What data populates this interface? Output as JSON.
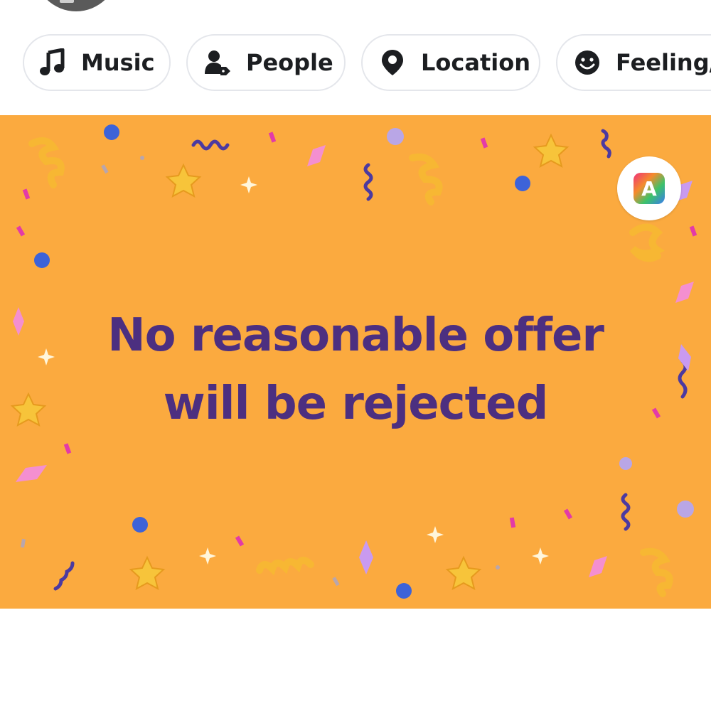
{
  "composer": {
    "attachments": [
      {
        "label": "Music",
        "icon": "music-note-icon"
      },
      {
        "label": "People",
        "icon": "tag-people-icon"
      },
      {
        "label": "Location",
        "icon": "location-pin-icon"
      },
      {
        "label": "Feeling/a",
        "icon": "smiley-face-icon"
      }
    ],
    "background_post": {
      "line1": "No reasonable offer",
      "line2": "will be rejected",
      "background_color": "#fbaa3f",
      "text_color": "#4c2f80",
      "theme": "confetti-celebration"
    },
    "text_style_button": {
      "label": "A",
      "icon": "text-style-icon"
    }
  }
}
